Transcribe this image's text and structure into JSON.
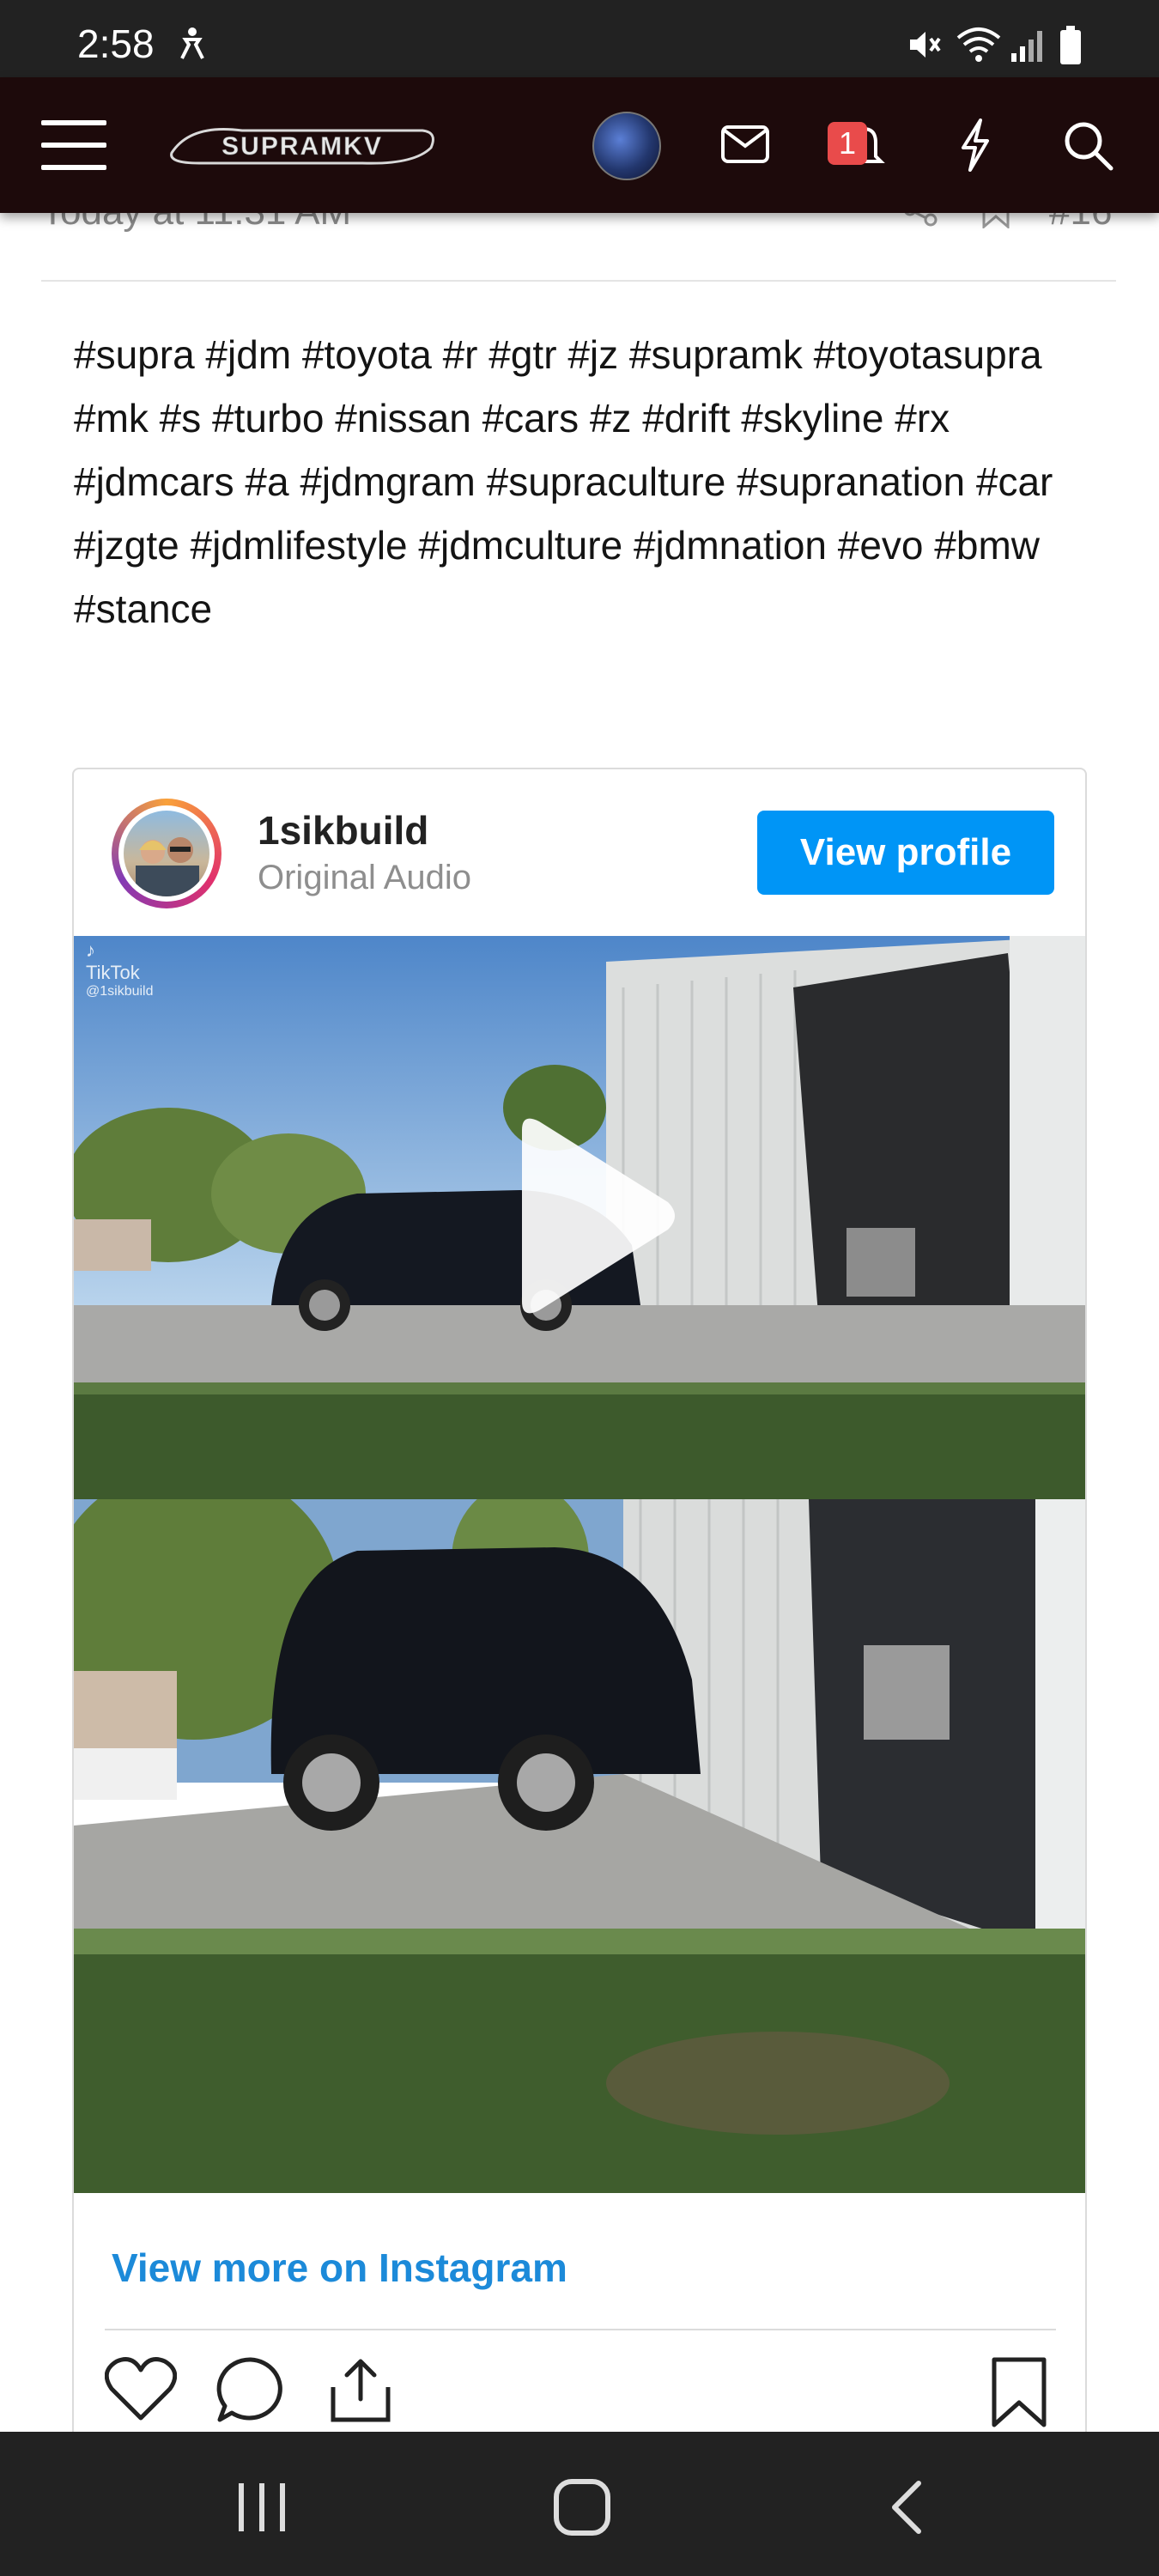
{
  "status_bar": {
    "time": "2:58",
    "icons": [
      "accessibility-icon",
      "mute-icon",
      "wifi-icon",
      "signal-icon",
      "battery-icon"
    ]
  },
  "header": {
    "logo_text": "SUPRAMKV",
    "notification_count": "1",
    "icons": [
      "menu-icon",
      "envelope-icon",
      "bell-icon",
      "lightning-icon",
      "search-icon"
    ]
  },
  "post": {
    "meta_time": "Today at 11:31 AM",
    "post_number": "#16",
    "hashtags": "#supra #jdm #toyota #r #gtr #jz #supramk #toyotasupra #mk #s #turbo #nissan #cars #z #drift #skyline #rx #jdmcars #a #jdmgram #supraculture #supranation #car #jzgte #jdmlifestyle #jdmculture #jdmnation #evo #bmw #stance"
  },
  "instagram": {
    "username": "1sikbuild",
    "audio": "Original Audio",
    "view_profile_label": "View profile",
    "tiktok_label": "TikTok",
    "tiktok_handle": "@1sikbuild",
    "view_more_label": "View more on Instagram",
    "actions": [
      "heart-icon",
      "comment-icon",
      "share-icon",
      "bookmark-icon"
    ]
  },
  "nav": {
    "buttons": [
      "recent-apps-icon",
      "home-icon",
      "back-icon"
    ]
  },
  "colors": {
    "header_bg": "#1d0a0b",
    "accent_blue": "#0095f6",
    "link_blue": "#1c8ad9",
    "badge_red": "#e94b4b"
  }
}
